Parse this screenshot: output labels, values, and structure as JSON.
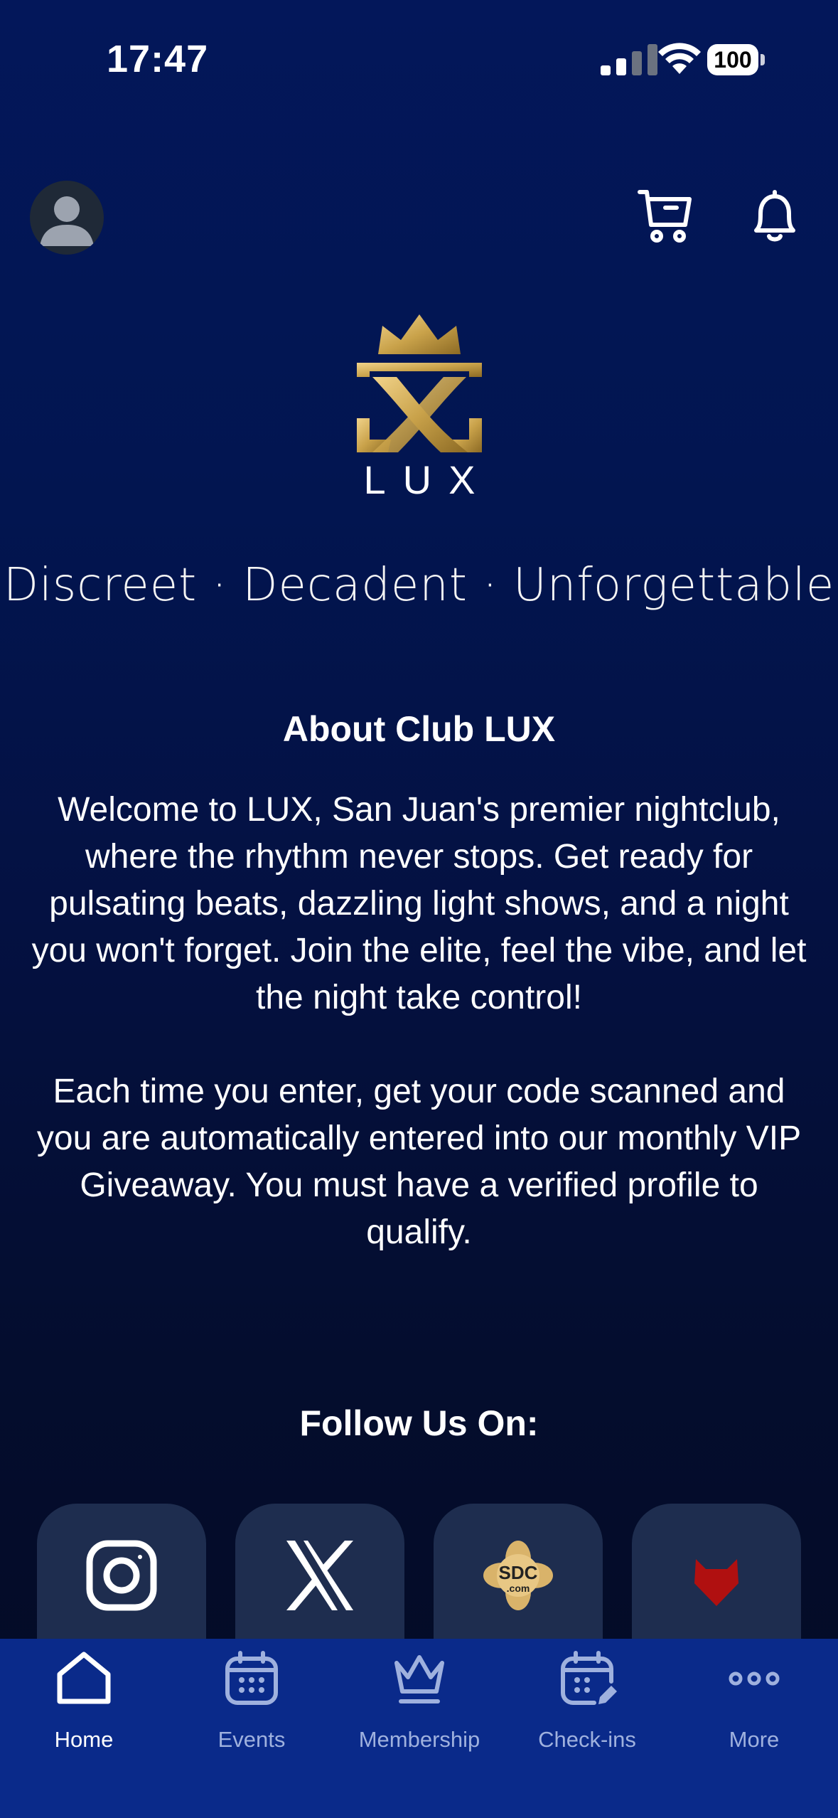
{
  "status_bar": {
    "time": "17:47",
    "battery": "100"
  },
  "brand": {
    "logo_text": "LUX",
    "tagline": "Discreet · Decadent · Unforgettable"
  },
  "about": {
    "title": "About Club LUX",
    "paragraph1": "Welcome to LUX, San Juan's premier nightclub, where the rhythm never stops. Get ready for pulsating beats, dazzling light shows, and a night you won't forget. Join the elite, feel the vibe, and let the night take control!",
    "paragraph2": "Each time you enter, get your code scanned and you are automatically entered into our monthly VIP Giveaway. You must have a verified profile to qualify."
  },
  "follow": {
    "title": "Follow Us On:",
    "sdc_label": "SDC",
    "sdc_sub": ".com"
  },
  "tabs": [
    {
      "label": "Home"
    },
    {
      "label": "Events"
    },
    {
      "label": "Membership"
    },
    {
      "label": "Check-ins"
    },
    {
      "label": "More"
    }
  ],
  "colors": {
    "background": "#021550",
    "tabbar": "#0a2a8a",
    "tile": "#1e2d4f",
    "gold": "#c9a24a",
    "red_icon": "#b01010"
  }
}
